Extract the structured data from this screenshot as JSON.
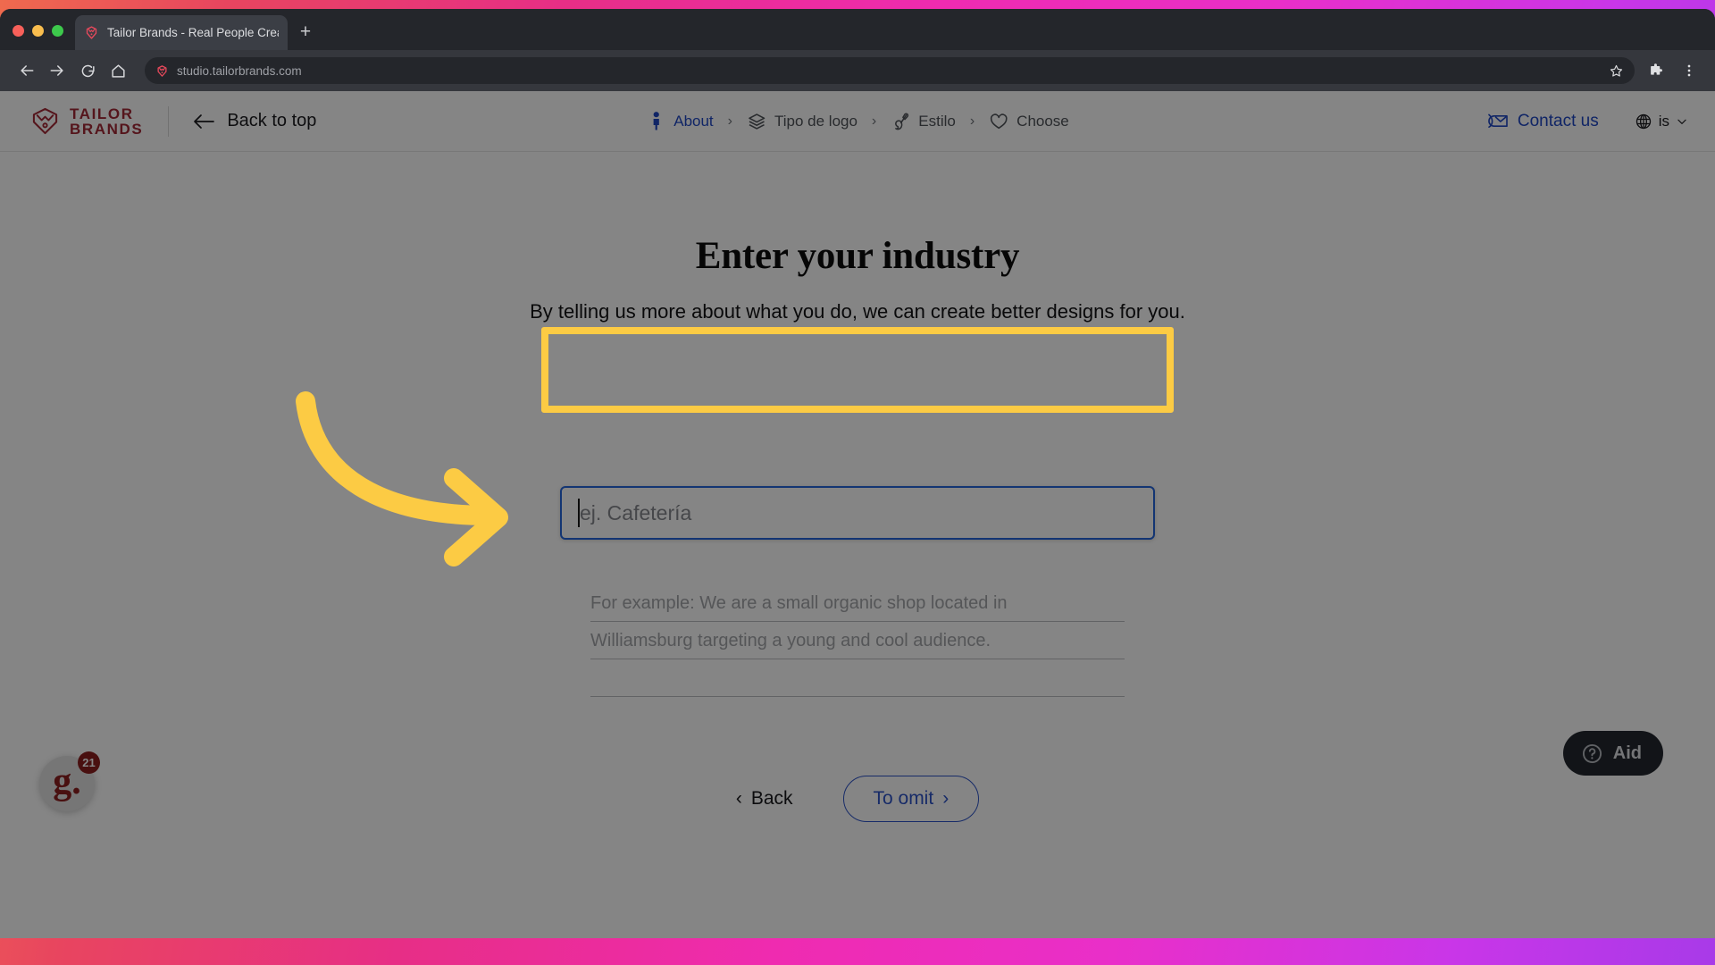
{
  "browser": {
    "tab": {
      "title": "Tailor Brands - Real People Creati",
      "favicon_name": "tailorbrands-favicon"
    },
    "new_tab_label": "+",
    "omnibox": {
      "url": "studio.tailorbrands.com"
    },
    "toolbar_icons": {
      "back": "back-arrow-icon",
      "forward": "forward-arrow-icon",
      "reload": "reload-icon",
      "home": "home-icon",
      "bookmark": "star-icon",
      "extensions": "puzzle-piece-icon",
      "menu": "three-dot-menu-icon"
    }
  },
  "header": {
    "brand": {
      "line1": "TAILOR",
      "line2": "BRANDS"
    },
    "back_to_top": "Back to top",
    "steps": [
      {
        "label": "About",
        "icon": "person-icon",
        "active": true
      },
      {
        "label": "Tipo de logo",
        "icon": "layers-icon",
        "active": false
      },
      {
        "label": "Estilo",
        "icon": "paintbrush-icon",
        "active": false
      },
      {
        "label": "Choose",
        "icon": "heart-icon",
        "active": false
      }
    ],
    "step_separator": "›",
    "contact_us": "Contact us",
    "language": "is",
    "language_chevron": "∨"
  },
  "main": {
    "title": "Enter your industry",
    "subtitle": "By telling us more about what you do, we can create better designs for you.",
    "industry_input": {
      "value": "",
      "placeholder": "ej. Cafetería"
    },
    "examples": [
      "For example: We are a small organic shop located in",
      "Williamsburg targeting a young and cool audience.",
      ""
    ]
  },
  "footer": {
    "back_label": "Back",
    "back_chevron": "‹",
    "omit_label": "To omit",
    "omit_chevron": "›"
  },
  "widgets": {
    "help_label": "Aid",
    "help_icon": "question-circle-icon",
    "g_badge_letter": "g.",
    "g_badge_count": "21"
  },
  "colors": {
    "brand_red": "#a42936",
    "link_blue": "#1f47c4",
    "focus_blue": "#2567dd",
    "highlight_yellow": "#fccb44",
    "help_dark": "#23272e"
  }
}
